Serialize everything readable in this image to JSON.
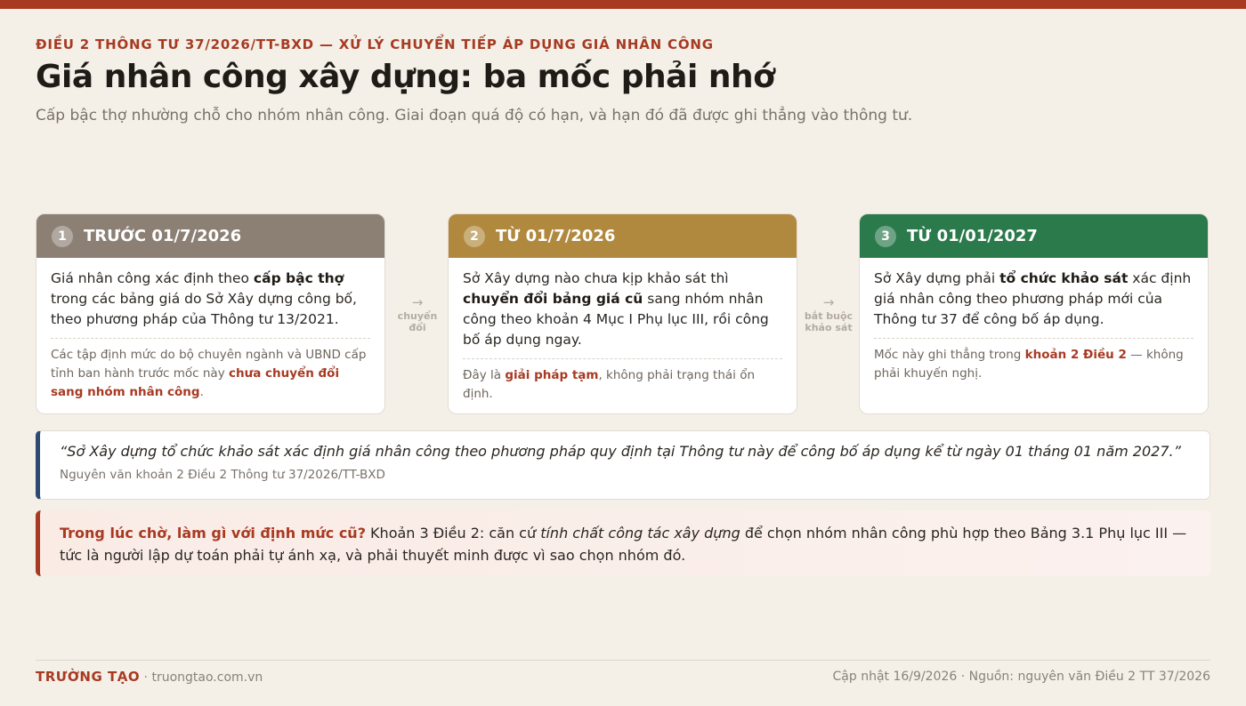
{
  "header": {
    "kicker": "ĐIỀU 2 THÔNG TƯ 37/2026/TT-BXD — XỬ LÝ CHUYỂN TIẾP ÁP DỤNG GIÁ NHÂN CÔNG",
    "title": "Giá nhân công xây dựng: ba mốc phải nhớ",
    "subtitle": "Cấp bậc thợ nhường chỗ cho nhóm nhân công. Giai đoạn quá độ có hạn, và hạn đó đã được ghi thẳng vào thông tư."
  },
  "colors": {
    "accent": "#a83a22",
    "stage1": "#8c8075",
    "stage2": "#b0893f",
    "stage3": "#2a7a4c",
    "quote_border": "#2e4a73"
  },
  "stages": [
    {
      "number": "1",
      "title": "TRƯỚC 01/7/2026",
      "main_pre": "Giá nhân công xác định theo ",
      "main_bold": "cấp bậc thợ",
      "main_post": " trong các bảng giá do Sở Xây dựng công bố, theo phương pháp của Thông tư 13/2021.",
      "note_pre": "Các tập định mức do bộ chuyên ngành và UBND cấp tỉnh ban hành trước mốc này ",
      "note_bold": "chưa chuyển đổi sang nhóm nhân công",
      "note_post": "."
    },
    {
      "number": "2",
      "title": "TỪ 01/7/2026",
      "main_pre": "Sở Xây dựng nào chưa kịp khảo sát thì ",
      "main_bold": "chuyển đổi bảng giá cũ",
      "main_post": " sang nhóm nhân công theo khoản 4 Mục I Phụ lục III, rồi công bố áp dụng ngay.",
      "note_pre": "Đây là ",
      "note_bold": "giải pháp tạm",
      "note_post": ", không phải trạng thái ổn định."
    },
    {
      "number": "3",
      "title": "TỪ 01/01/2027",
      "main_pre": "Sở Xây dựng phải ",
      "main_bold": "tổ chức khảo sát",
      "main_post": " xác định giá nhân công theo phương pháp mới của Thông tư 37 để công bố áp dụng.",
      "note_pre": "Mốc này ghi thẳng trong ",
      "note_bold": "khoản 2 Điều 2",
      "note_post": " — không phải khuyến nghị."
    }
  ],
  "arrows": [
    {
      "symbol": "→",
      "label_line1": "chuyển",
      "label_line2": "đổi"
    },
    {
      "symbol": "→",
      "label_line1": "bắt buộc",
      "label_line2": "khảo sát"
    }
  ],
  "quote": {
    "text": "“Sở Xây dựng tổ chức khảo sát xác định giá nhân công theo phương pháp quy định tại Thông tư này để công bố áp dụng kể từ ngày 01 tháng 01 năm 2027.”",
    "source": "Nguyên văn khoản 2 Điều 2 Thông tư 37/2026/TT-BXD"
  },
  "callout": {
    "lead": "Trong lúc chờ, làm gì với định mức cũ?",
    "text_pre": " Khoản 3 Điều 2: căn cứ ",
    "text_italic": "tính chất công tác xây dựng",
    "text_post": " để chọn nhóm nhân công phù hợp theo Bảng 3.1 Phụ lục III — tức là người lập dự toán phải tự ánh xạ, và phải thuyết minh được vì sao chọn nhóm đó."
  },
  "footer": {
    "brand": "TRƯỜNG TẠO",
    "site": " · truongtao.com.vn",
    "meta": "Cập nhật 16/9/2026 · Nguồn: nguyên văn Điều 2 TT 37/2026"
  }
}
